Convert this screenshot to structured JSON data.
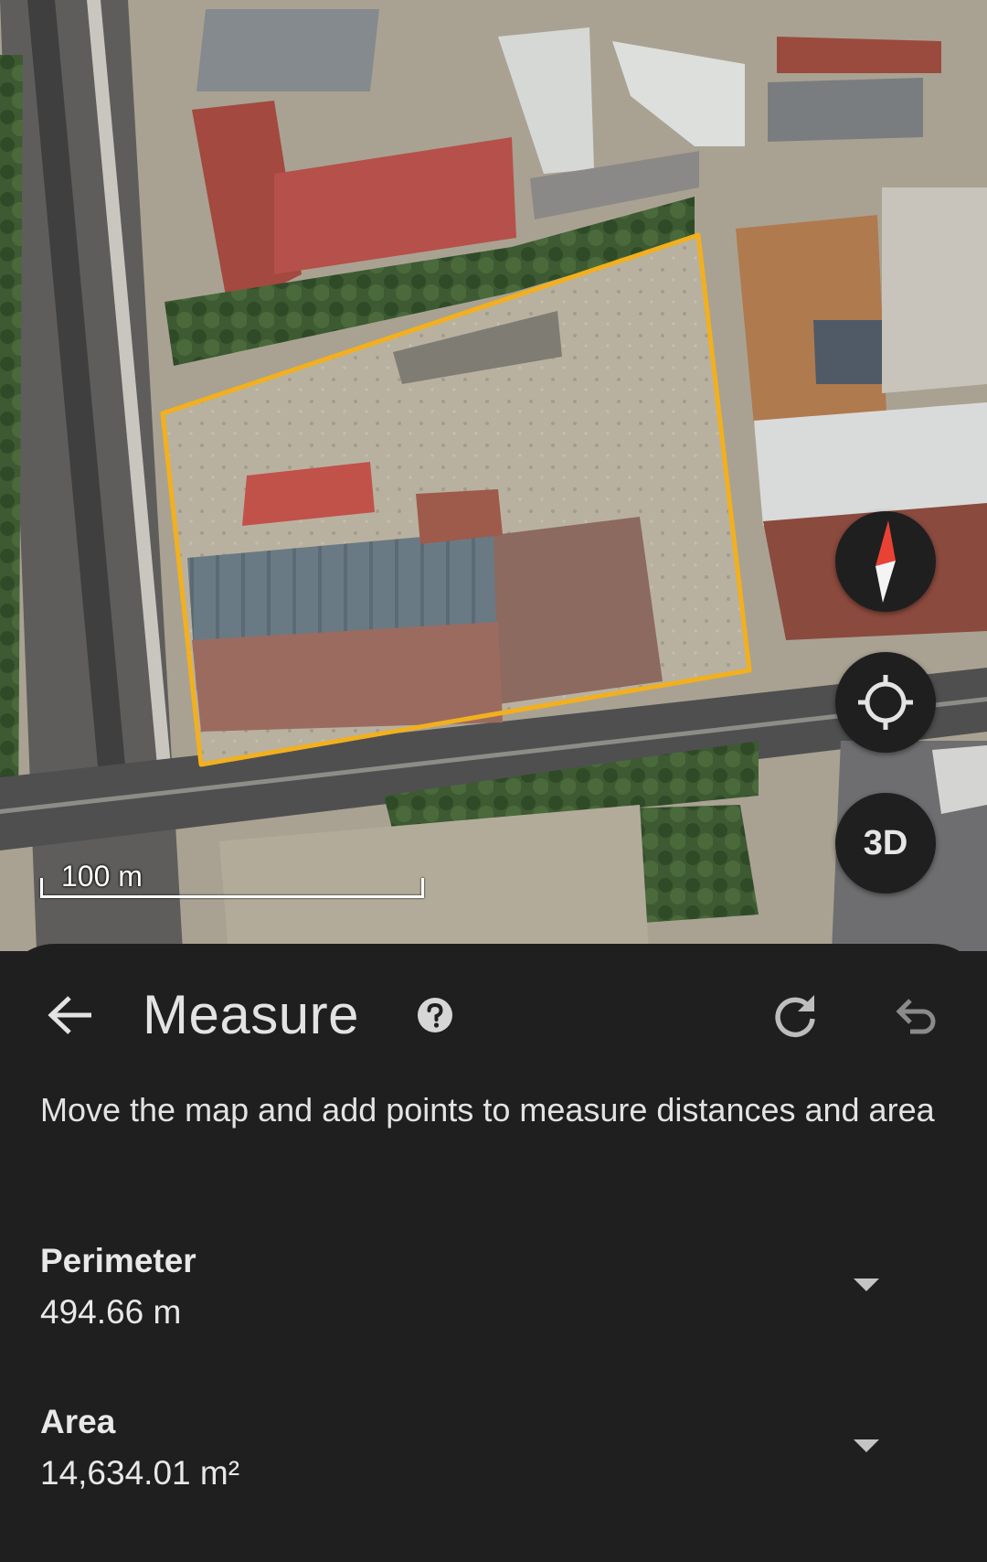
{
  "map": {
    "scale_label": "100 m",
    "three_d_label": "3D",
    "outline_color": "#f2b01e",
    "compass_color": "#e94235"
  },
  "panel": {
    "title": "Measure",
    "instructions": "Move the map and add points to measure distances and area",
    "perimeter": {
      "label": "Perimeter",
      "value": "494.66 m"
    },
    "area": {
      "label": "Area",
      "value": "14,634.01 m²"
    }
  },
  "icons": {
    "back": "arrow-back-icon",
    "help": "help-circle-icon",
    "redo": "redo-icon",
    "undo": "undo-icon",
    "compass": "compass-icon",
    "my_location": "my-location-icon",
    "expand": "chevron-down-icon"
  }
}
